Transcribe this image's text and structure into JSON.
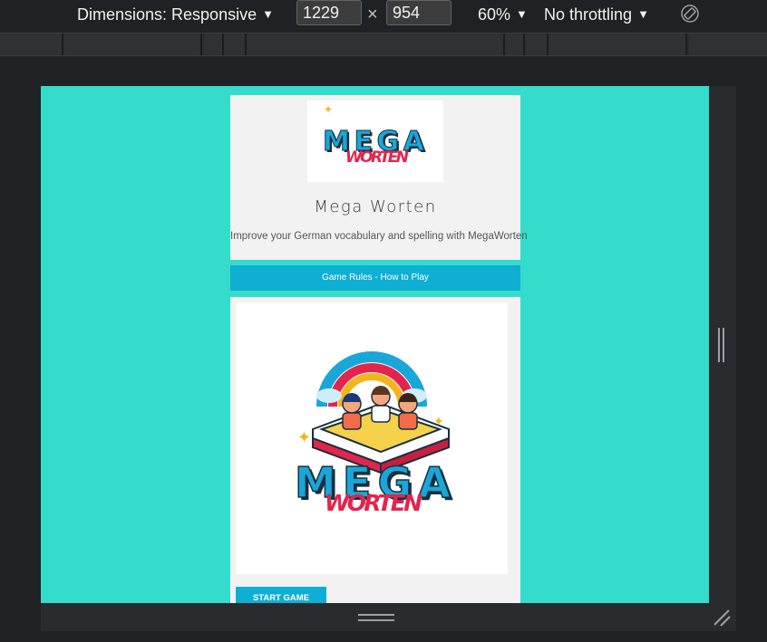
{
  "toolbar": {
    "dimensions_label": "Dimensions: Responsive",
    "width_value": "1229",
    "times": "×",
    "height_value": "954",
    "zoom_label": "60%",
    "throttling_label": "No throttling",
    "caret": "▼",
    "rotate_icon": "rotate-icon"
  },
  "page": {
    "logo_line1": "MEGA",
    "logo_line2": "WORTEN",
    "title": "Mega Worten",
    "subtitle": "Improve your German vocabulary and spelling with MegaWorten",
    "rules_button": "Game Rules - How to Play",
    "start_button": "START GAME"
  },
  "colors": {
    "viewport_bg": "#33dccb",
    "button_bg": "#0fafd4",
    "logo_blue": "#1aa6d8",
    "logo_red": "#e4244b"
  }
}
